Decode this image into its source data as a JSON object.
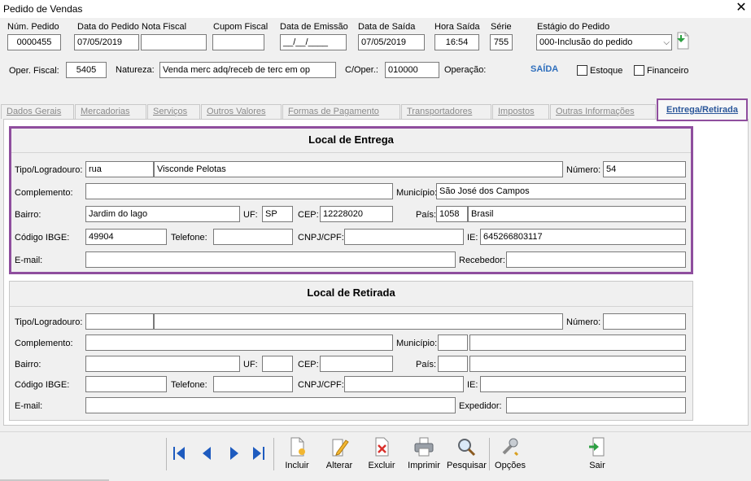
{
  "window": {
    "title": "Pedido de Vendas",
    "close_glyph": "✕"
  },
  "header": {
    "num_pedido_label": "Núm. Pedido",
    "num_pedido": "0000455",
    "data_pedido_label": "Data do Pedido",
    "data_pedido": "07/05/2019",
    "nota_fiscal_label": "Nota Fiscal",
    "nota_fiscal": "",
    "cupom_fiscal_label": "Cupom Fiscal",
    "cupom_fiscal": "",
    "data_emissao_label": "Data de Emissão",
    "data_emissao": "__/__/____",
    "data_saida_label": "Data de Saída",
    "data_saida": "07/05/2019",
    "hora_saida_label": "Hora Saída",
    "hora_saida": "16:54",
    "serie_label": "Série",
    "serie": "755",
    "estagio_label": "Estágio do Pedido",
    "estagio": "000-Inclusão do pedido",
    "oper_fiscal_label": "Oper. Fiscal:",
    "oper_fiscal": "5405",
    "natureza_label": "Natureza:",
    "natureza": "Venda merc adq/receb de terc em op",
    "c_oper_label": "C/Oper.:",
    "c_oper": "010000",
    "operacao_label": "Operação:",
    "operacao": "SAÍDA",
    "estoque_label": "Estoque",
    "financeiro_label": "Financeiro"
  },
  "tabs": [
    "Dados Gerais",
    "Mercadorias",
    "Serviços",
    "Outros Valores",
    "Formas de Pagamento",
    "Transportadores",
    "Impostos",
    "Outras Informações",
    "Entrega/Retirada"
  ],
  "labels": {
    "tipo": "Tipo/Logradouro:",
    "numero": "Número:",
    "complemento": "Complemento:",
    "municipio": "Município:",
    "bairro": "Bairro:",
    "uf": "UF:",
    "cep": "CEP:",
    "pais": "País:",
    "ibge": "Código IBGE:",
    "telefone": "Telefone:",
    "cnpj": "CNPJ/CPF:",
    "ie": "IE:",
    "email": "E-mail:",
    "recebedor": "Recebedor:",
    "expedidor": "Expedidor:"
  },
  "entrega": {
    "title": "Local de Entrega",
    "tipo": "rua",
    "logradouro": "Visconde Pelotas",
    "numero": "54",
    "complemento": "",
    "municipio": "São José dos Campos",
    "bairro": "Jardim do lago",
    "uf": "SP",
    "cep": "12228020",
    "pais_cod": "1058",
    "pais": "Brasil",
    "ibge": "49904",
    "telefone": "",
    "cnpj": "",
    "ie": "645266803117",
    "email": "",
    "recebedor": ""
  },
  "retirada": {
    "title": "Local de Retirada",
    "tipo": "",
    "logradouro": "",
    "numero": "",
    "complemento": "",
    "municipio_cod": "",
    "municipio": "",
    "bairro": "",
    "uf": "",
    "cep": "",
    "pais_cod": "",
    "pais": "",
    "ibge": "",
    "telefone": "",
    "cnpj": "",
    "ie": "",
    "email": "",
    "expedidor": ""
  },
  "toolbar": {
    "incluir": "Incluir",
    "alterar": "Alterar",
    "excluir": "Excluir",
    "imprimir": "Imprimir",
    "pesquisar": "Pesquisar",
    "opcoes": "Opções",
    "sair": "Sair"
  },
  "colors": {
    "accent_purple": "#8f4e9e",
    "saida_blue": "#2f6fbd",
    "nav_blue": "#1e5bbf"
  }
}
